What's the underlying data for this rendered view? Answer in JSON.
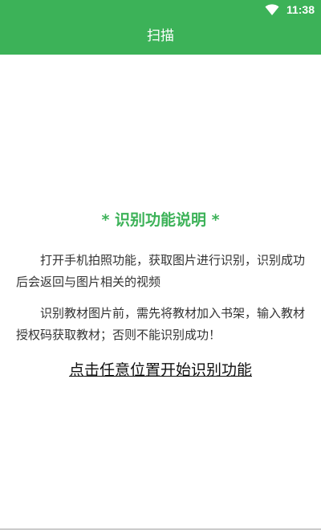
{
  "status_bar": {
    "time": "11:38",
    "icons": [
      "wifi-icon"
    ]
  },
  "app_bar": {
    "title": "扫描"
  },
  "instructions": {
    "title": "* 识别功能说明 *",
    "paragraph1": "打开手机拍照功能，获取图片进行识别，识别成功后会返回与图片相关的视频",
    "paragraph2": "识别教材图片前，需先将教材加入书架，输入教材授权码获取教材；否则不能识别成功！",
    "start_link": "点击任意位置开始识别功能"
  },
  "colors": {
    "accent": "#3cb258",
    "text": "#333333"
  }
}
